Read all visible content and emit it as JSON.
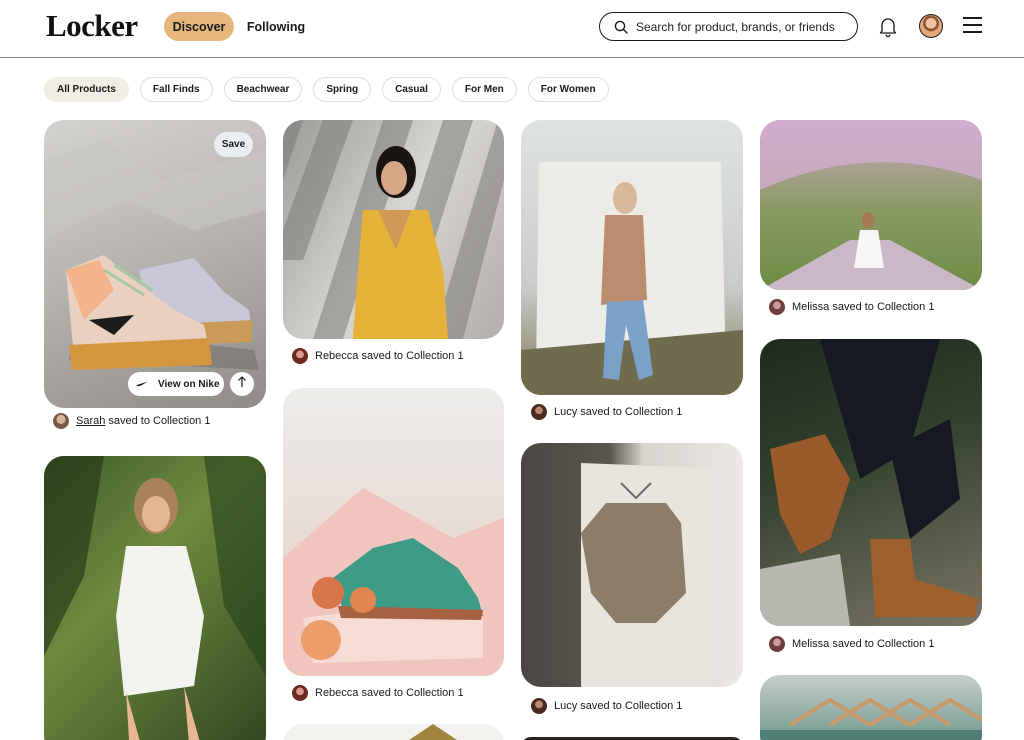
{
  "app": {
    "logo": "Locker"
  },
  "nav": {
    "discover": "Discover",
    "following": "Following"
  },
  "search": {
    "placeholder": "Search for product, brands, or friends"
  },
  "icons": {
    "search": "search-icon",
    "bell": "bell-icon",
    "menu": "menu-icon",
    "share": "share-icon",
    "brand": "nike-swoosh-icon"
  },
  "colors": {
    "accent": "#e5b77c",
    "chip_active": "#f1ece4",
    "save_button": "#e9eef3"
  },
  "filters": [
    "All Products",
    "Fall Finds",
    "Beachwear",
    "Spring",
    "Casual",
    "For Men",
    "For Women"
  ],
  "active_filter": "All Products",
  "pins": {
    "sneakers": {
      "save_label": "Save",
      "view_label": "View on Nike",
      "caption_user": "Sarah",
      "caption_text": "saved to Collection 1"
    },
    "yellow_dress": {
      "caption": "Rebecca saved to Collection 1"
    },
    "green_shoes": {
      "caption": "Rebecca saved to Collection 1"
    },
    "trench_coat": {
      "caption": "Lucy saved to Collection 1"
    },
    "sweater": {
      "caption": "Lucy saved to Collection 1"
    },
    "white_dress": {
      "caption": "Melissa saved to Collection 1"
    },
    "boots": {
      "caption": "Melissa saved to Collection 1"
    }
  }
}
